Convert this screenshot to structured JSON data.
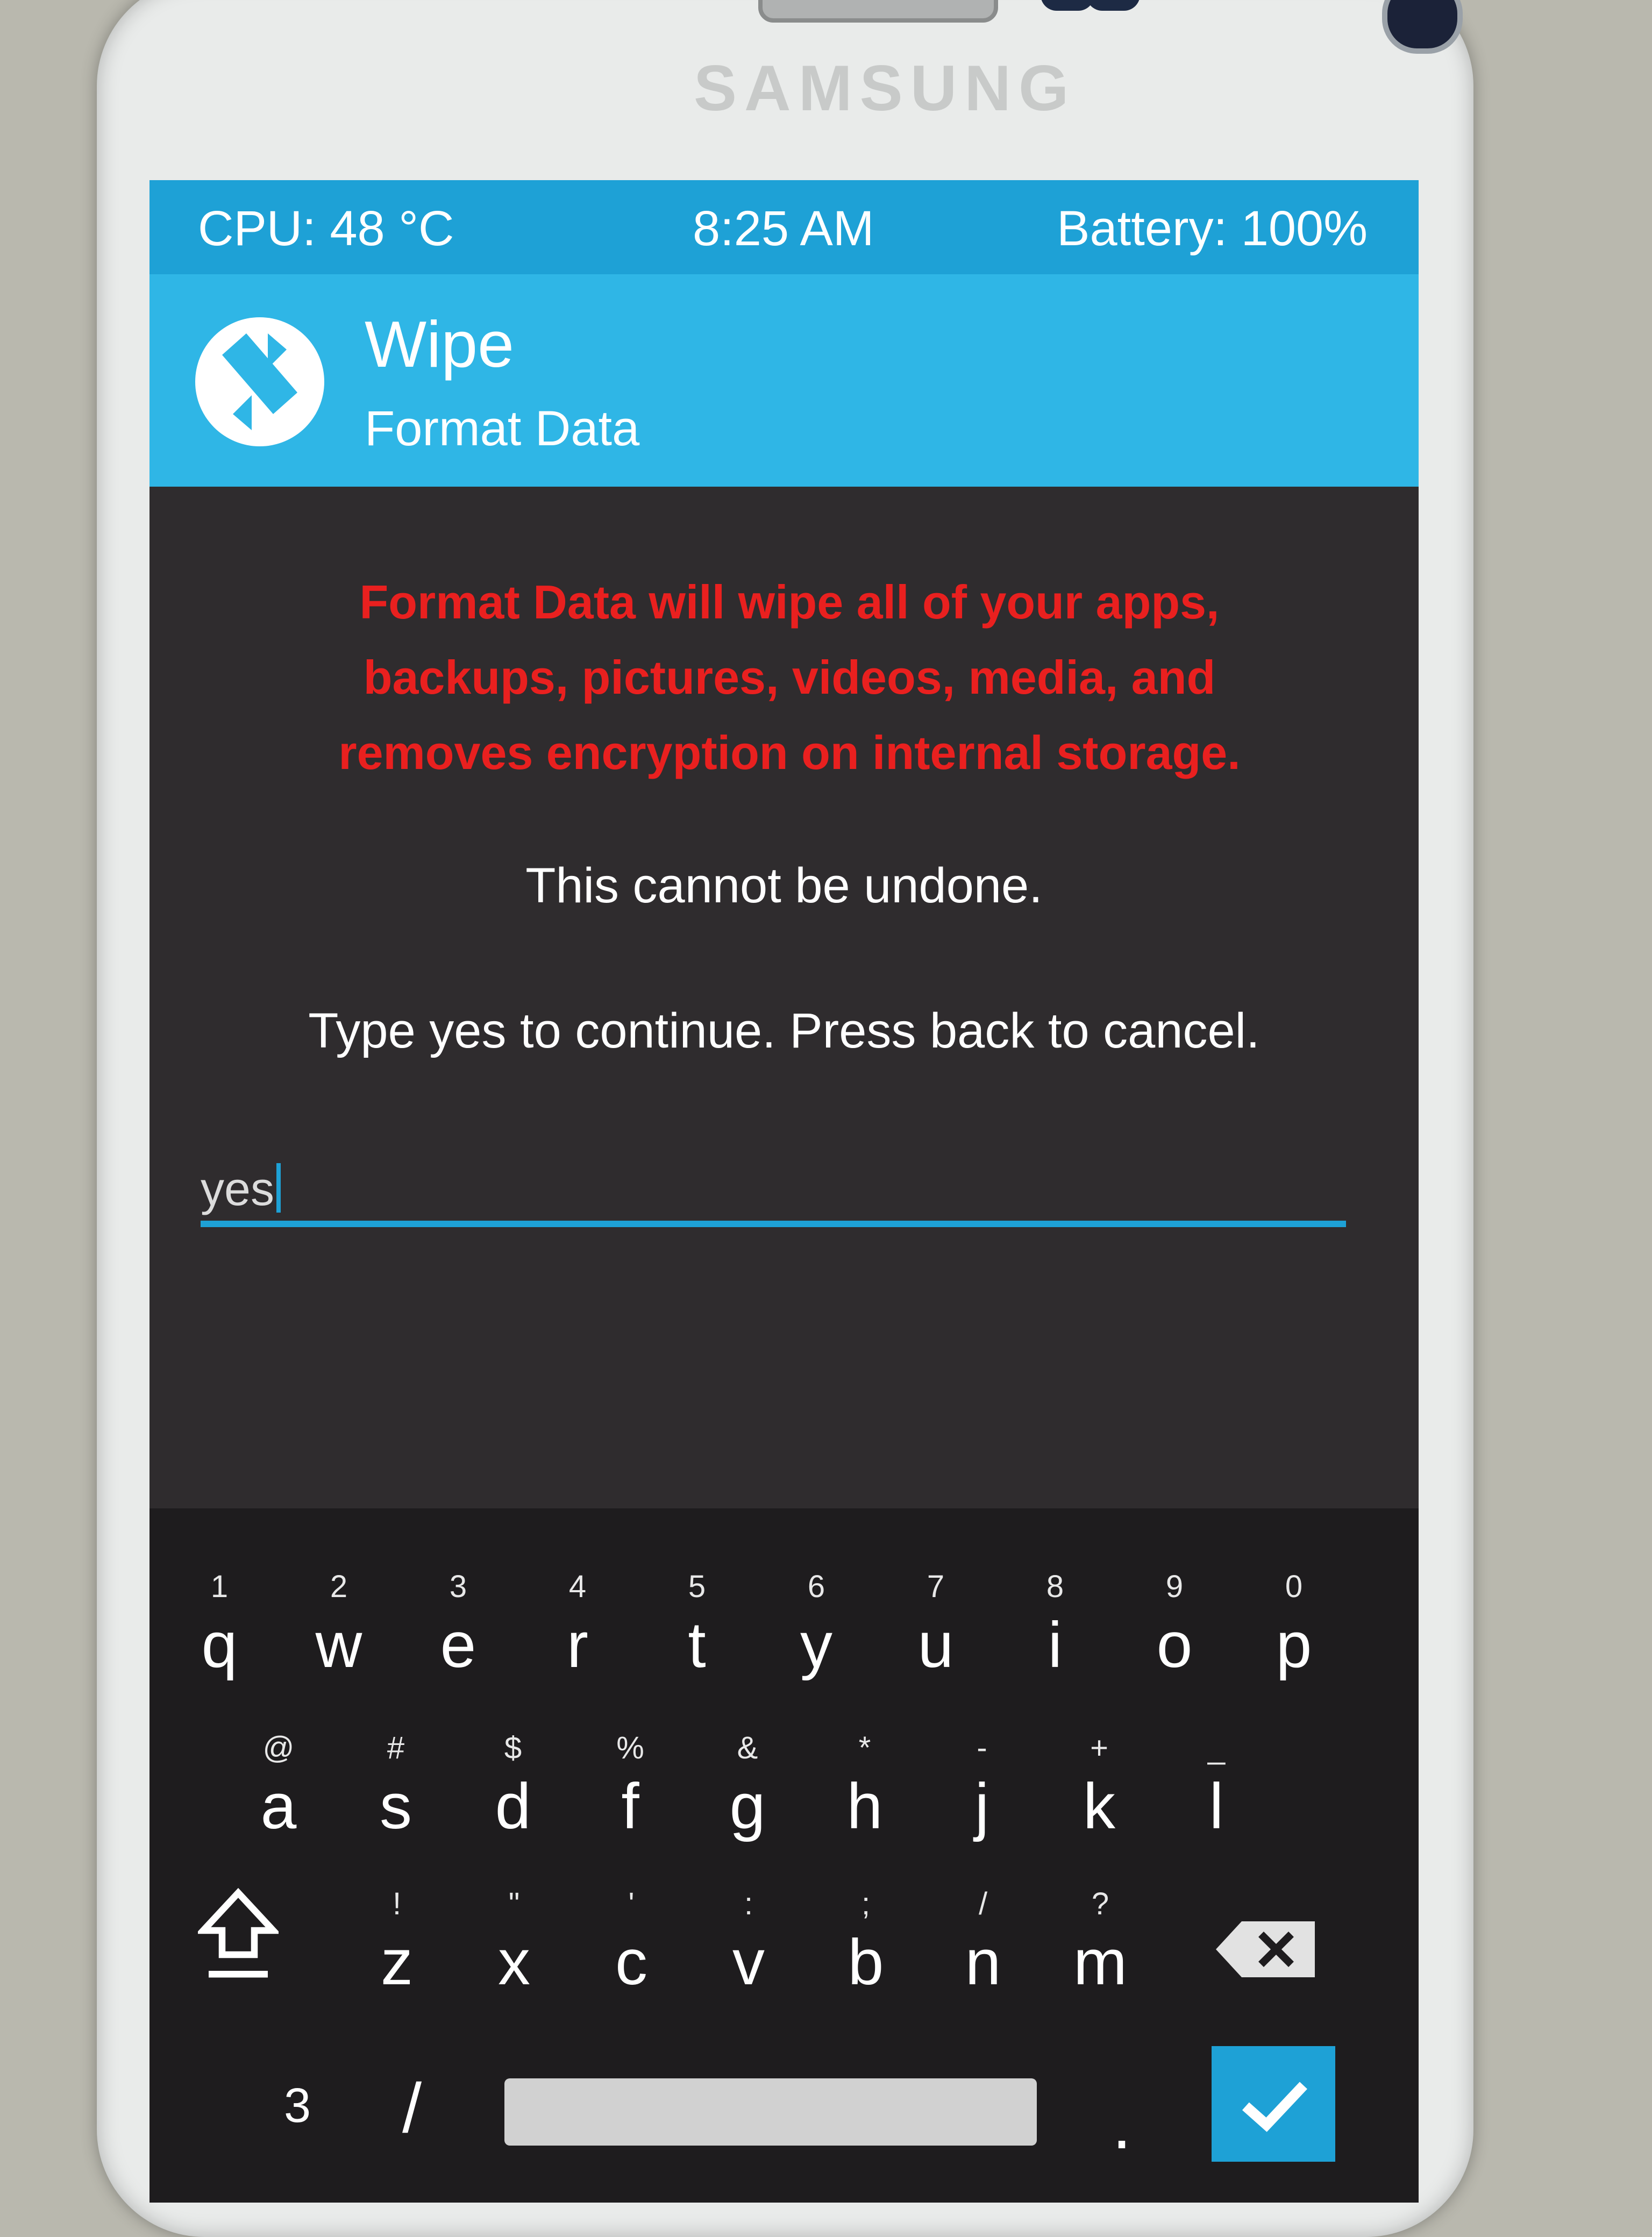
{
  "device": {
    "brand": "SAMSUNG"
  },
  "status_bar": {
    "cpu": "CPU: 48 °C",
    "time": "8:25 AM",
    "battery": "Battery: 100%"
  },
  "header": {
    "title": "Wipe",
    "subtitle": "Format Data"
  },
  "content": {
    "warning": "Format Data will wipe all of your apps, backups, pictures, videos, media, and removes encryption on internal storage.",
    "undone": "This cannot be undone.",
    "prompt": "Type yes to continue.  Press back to cancel."
  },
  "input": {
    "value": "yes"
  },
  "keyboard": {
    "row1": [
      {
        "alt": "1",
        "key": "q"
      },
      {
        "alt": "2",
        "key": "w"
      },
      {
        "alt": "3",
        "key": "e"
      },
      {
        "alt": "4",
        "key": "r"
      },
      {
        "alt": "5",
        "key": "t"
      },
      {
        "alt": "6",
        "key": "y"
      },
      {
        "alt": "7",
        "key": "u"
      },
      {
        "alt": "8",
        "key": "i"
      },
      {
        "alt": "9",
        "key": "o"
      },
      {
        "alt": "0",
        "key": "p"
      }
    ],
    "row2": [
      {
        "alt": "@",
        "key": "a"
      },
      {
        "alt": "#",
        "key": "s"
      },
      {
        "alt": "$",
        "key": "d"
      },
      {
        "alt": "%",
        "key": "f"
      },
      {
        "alt": "&",
        "key": "g"
      },
      {
        "alt": "*",
        "key": "h"
      },
      {
        "alt": "-",
        "key": "j"
      },
      {
        "alt": "+",
        "key": "k"
      },
      {
        "alt": "_",
        "key": "l"
      }
    ],
    "row3": [
      {
        "alt": "!",
        "key": "z"
      },
      {
        "alt": "\"",
        "key": "x"
      },
      {
        "alt": "'",
        "key": "c"
      },
      {
        "alt": ":",
        "key": "v"
      },
      {
        "alt": ";",
        "key": "b"
      },
      {
        "alt": "/",
        "key": "n"
      },
      {
        "alt": "?",
        "key": "m"
      }
    ],
    "bottom": {
      "num": "3",
      "slash": "/",
      "dot": "."
    },
    "icons": {
      "shift": "shift-icon",
      "backspace": "backspace-icon",
      "enter": "checkmark-icon"
    }
  },
  "colors": {
    "accent": "#1ea1d6",
    "header": "#2fb6e6",
    "warning": "#e9201f",
    "background": "#2f2c2e"
  }
}
